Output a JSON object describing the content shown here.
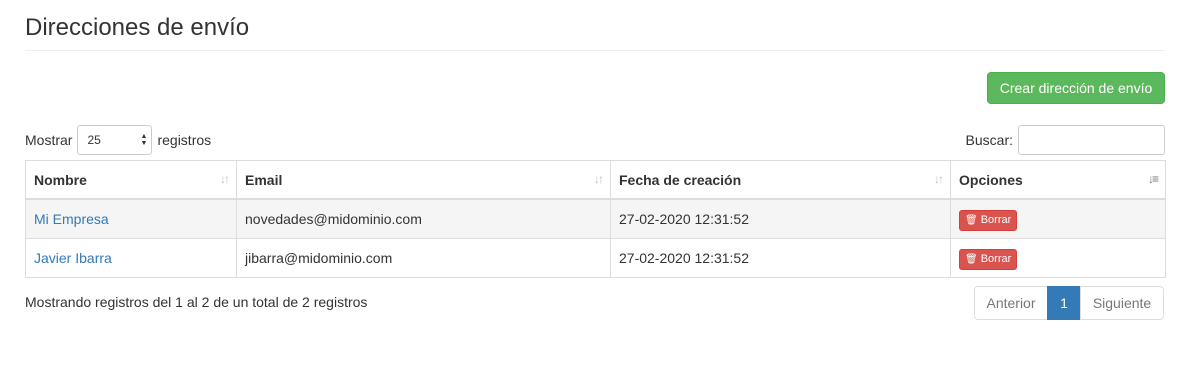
{
  "page": {
    "title": "Direcciones de envío"
  },
  "toolbar": {
    "create_label": "Crear dirección de envío"
  },
  "length": {
    "prefix": "Mostrar",
    "value": "25",
    "suffix": "registros"
  },
  "search": {
    "label": "Buscar:",
    "value": ""
  },
  "table": {
    "columns": [
      "Nombre",
      "Email",
      "Fecha de creación",
      "Opciones"
    ],
    "rows": [
      {
        "name": "Mi Empresa",
        "email": "novedades@midominio.com",
        "created": "27-02-2020 12:31:52",
        "action": "Borrar"
      },
      {
        "name": "Javier Ibarra",
        "email": "jibarra@midominio.com",
        "created": "27-02-2020 12:31:52",
        "action": "Borrar"
      }
    ]
  },
  "info": "Mostrando registros del 1 al 2 de un total de 2 registros",
  "pagination": {
    "prev": "Anterior",
    "current": "1",
    "next": "Siguiente"
  },
  "colors": {
    "primary": "#337ab7",
    "success": "#5cb85c",
    "danger": "#d9534f"
  }
}
